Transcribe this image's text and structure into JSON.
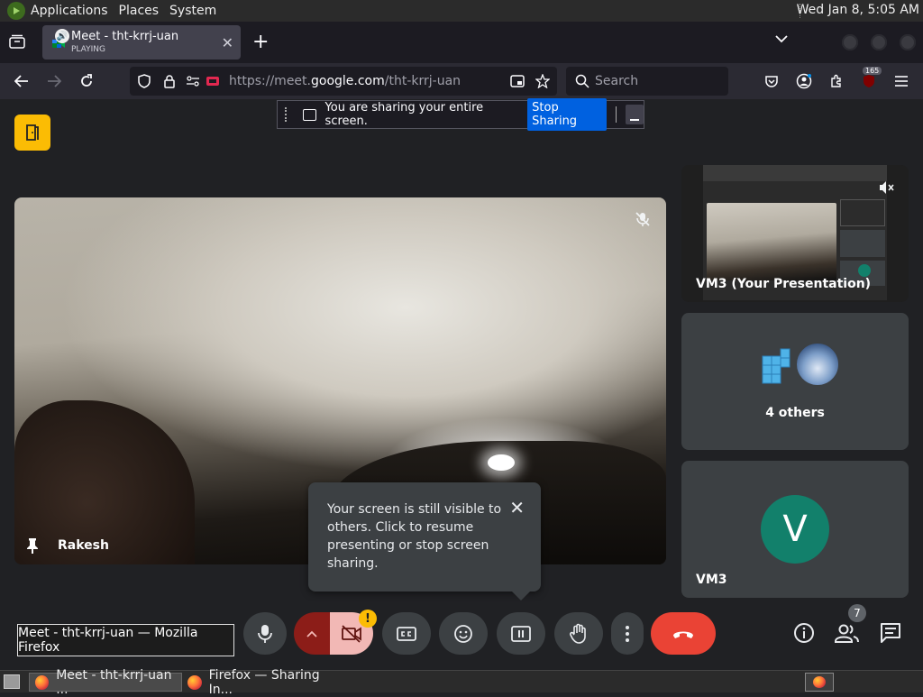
{
  "top_panel": {
    "menus": [
      "Applications",
      "Places",
      "System"
    ],
    "clock": "Wed Jan  8,  5:05 AM"
  },
  "browser": {
    "tab": {
      "title": "Meet - tht-krrj-uan",
      "status": "PLAYING"
    },
    "url": {
      "prefix": "https://meet.",
      "domain": "google.com",
      "path": "/tht-krrj-uan"
    },
    "search_placeholder": "Search",
    "extensions_badge": "165"
  },
  "sharing_bar": {
    "message": "You are sharing your entire screen.",
    "stop_label": "Stop Sharing"
  },
  "meet": {
    "main_participant": "Rakesh",
    "tiles": [
      {
        "label": "VM3 (Your Presentation)"
      },
      {
        "label": "4 others"
      },
      {
        "label": "VM3",
        "initial": "V"
      }
    ],
    "tooltip": "Your screen is still visible to others. Click to resume presenting or stop screen sharing.",
    "people_count": "7",
    "camera_alert": "!"
  },
  "taskbar": {
    "hover_tooltip": "Meet - tht-krrj-uan — Mozilla Firefox",
    "items": [
      "Meet - tht-krrj-uan ...",
      "Firefox — Sharing In..."
    ]
  },
  "colors": {
    "meet_bg": "#202124",
    "tile_bg": "#3c4043",
    "leave_red": "#ea4335",
    "stop_sharing_blue": "#0061e0",
    "vm3_avatar": "#12806b",
    "alert_yellow": "#fbbc04"
  }
}
